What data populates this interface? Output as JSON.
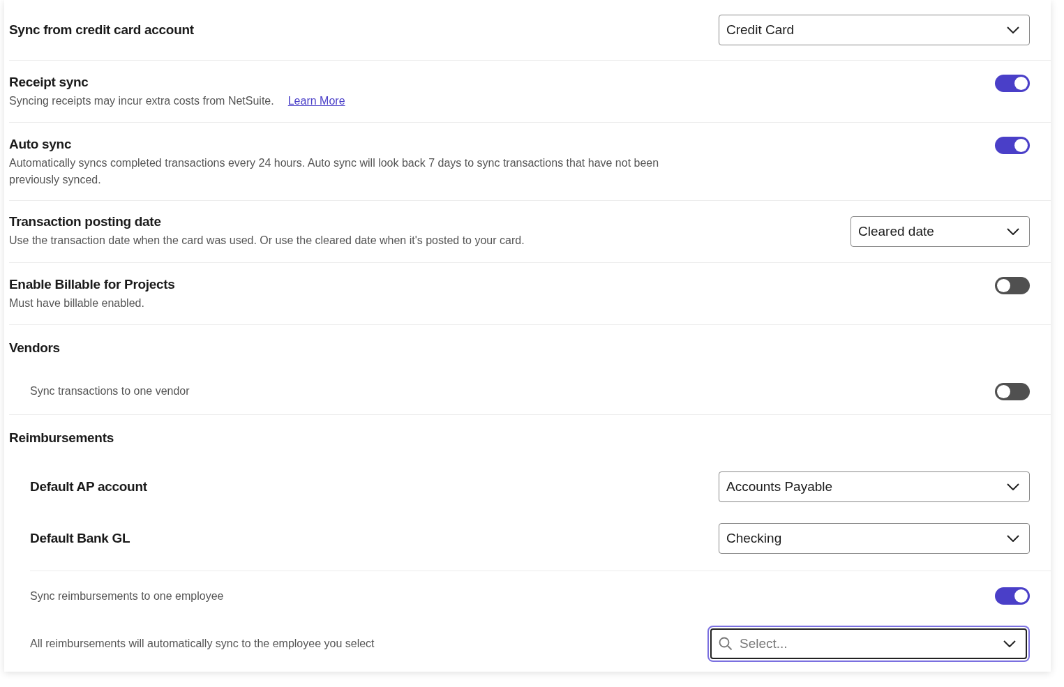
{
  "settings": [
    {
      "kind": "select",
      "title": "Sync from credit card account",
      "value": "Credit Card"
    },
    {
      "kind": "toggle",
      "title": "Receipt sync",
      "description": "Syncing receipts may incur extra costs from NetSuite.",
      "link": "Learn More",
      "on": true
    },
    {
      "kind": "toggle",
      "title": "Auto sync",
      "description": "Automatically syncs completed transactions every 24 hours. Auto sync will look back 7 days to sync transactions that have not been previously synced.",
      "on": true
    },
    {
      "kind": "short-select",
      "title": "Transaction posting date",
      "description": "Use the transaction date when the card was used. Or use the cleared date when it's posted to your card.",
      "value": "Cleared date"
    },
    {
      "kind": "toggle",
      "title": "Enable Billable for Projects",
      "description": "Must have billable enabled.",
      "on": false
    },
    {
      "kind": "section",
      "title": "Vendors",
      "items": [
        {
          "kind": "toggle-option",
          "label": "Sync transactions to one vendor",
          "on": false
        }
      ]
    },
    {
      "kind": "section",
      "title": "Reimbursements",
      "items": [
        {
          "kind": "select",
          "title": "Default AP account",
          "value": "Accounts Payable"
        },
        {
          "kind": "select",
          "title": "Default Bank GL",
          "value": "Checking"
        },
        {
          "kind": "toggle-option",
          "label": "Sync reimbursements to one employee",
          "on": true
        },
        {
          "kind": "search-select",
          "label": "All reimbursements will automatically sync to the employee you select",
          "placeholder": "Select...",
          "focused": true
        }
      ]
    }
  ]
}
